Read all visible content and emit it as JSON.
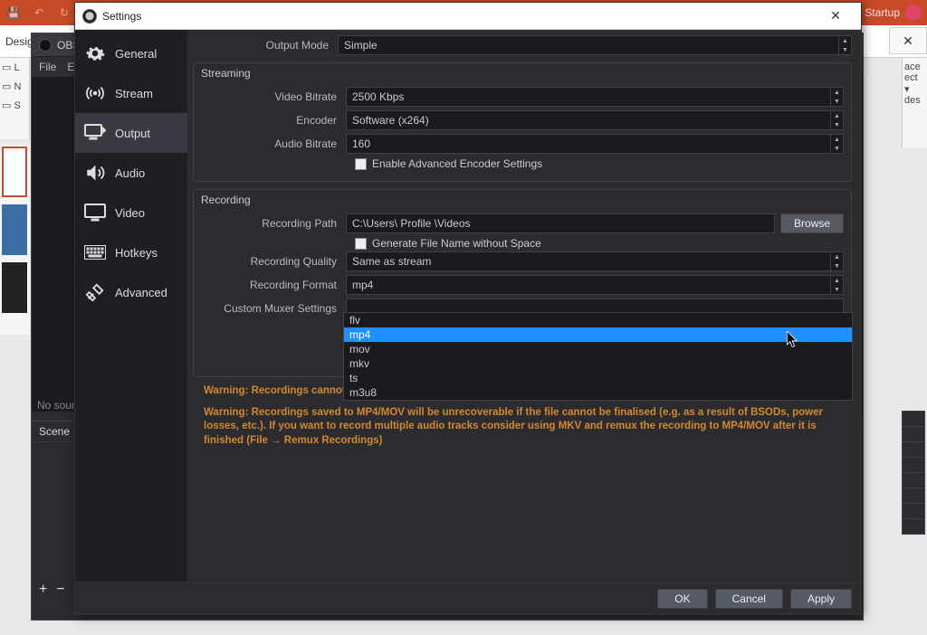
{
  "ppt": {
    "topbar_right": "ard Startup"
  },
  "obs_back": {
    "title": "OBS",
    "menu_file": "File",
    "menu_e": "E",
    "nosource": "No source",
    "panel_scene": "Scene",
    "btn_add": "+",
    "btn_remove": "−"
  },
  "dialog": {
    "title": "Settings",
    "close": "✕",
    "footer": {
      "ok": "OK",
      "cancel": "Cancel",
      "apply": "Apply"
    }
  },
  "sidebar": {
    "items": [
      {
        "label": "General"
      },
      {
        "label": "Stream"
      },
      {
        "label": "Output"
      },
      {
        "label": "Audio"
      },
      {
        "label": "Video"
      },
      {
        "label": "Hotkeys"
      },
      {
        "label": "Advanced"
      }
    ]
  },
  "output": {
    "mode_label": "Output Mode",
    "mode_value": "Simple",
    "streaming": {
      "title": "Streaming",
      "bitrate_label": "Video Bitrate",
      "bitrate_value": "2500 Kbps",
      "encoder_label": "Encoder",
      "encoder_value": "Software (x264)",
      "audio_bitrate_label": "Audio Bitrate",
      "audio_bitrate_value": "160",
      "adv_check_label": "Enable Advanced Encoder Settings"
    },
    "recording": {
      "title": "Recording",
      "path_label": "Recording Path",
      "path_value": "C:\\Users\\ Profile \\Videos",
      "browse": "Browse",
      "noSpace_label": "Generate File Name without Space",
      "quality_label": "Recording Quality",
      "quality_value": "Same as stream",
      "format_label": "Recording Format",
      "format_value": "mp4",
      "muxer_label": "Custom Muxer Settings",
      "format_options": [
        "flv",
        "mp4",
        "mov",
        "mkv",
        "ts",
        "m3u8"
      ],
      "selected_option": "mp4"
    },
    "warning1": "Warning: Recordings cannot be paused if the recording quality is set to \"Same as stream\".",
    "warning2": "Warning: Recordings saved to MP4/MOV will be unrecoverable if the file cannot be finalised (e.g. as a result of BSODs, power losses, etc.). If you want to record multiple audio tracks consider using MKV and remux the recording to MP4/MOV after it is finished (File → Remux Recordings)"
  },
  "right_frag": {
    "l1": "ace",
    "l2": "ect ▾",
    "l3": "des"
  },
  "left_frag": {
    "design": "Design",
    "a": "▭ L",
    "b": "▭ N",
    "c": "▭ S"
  }
}
